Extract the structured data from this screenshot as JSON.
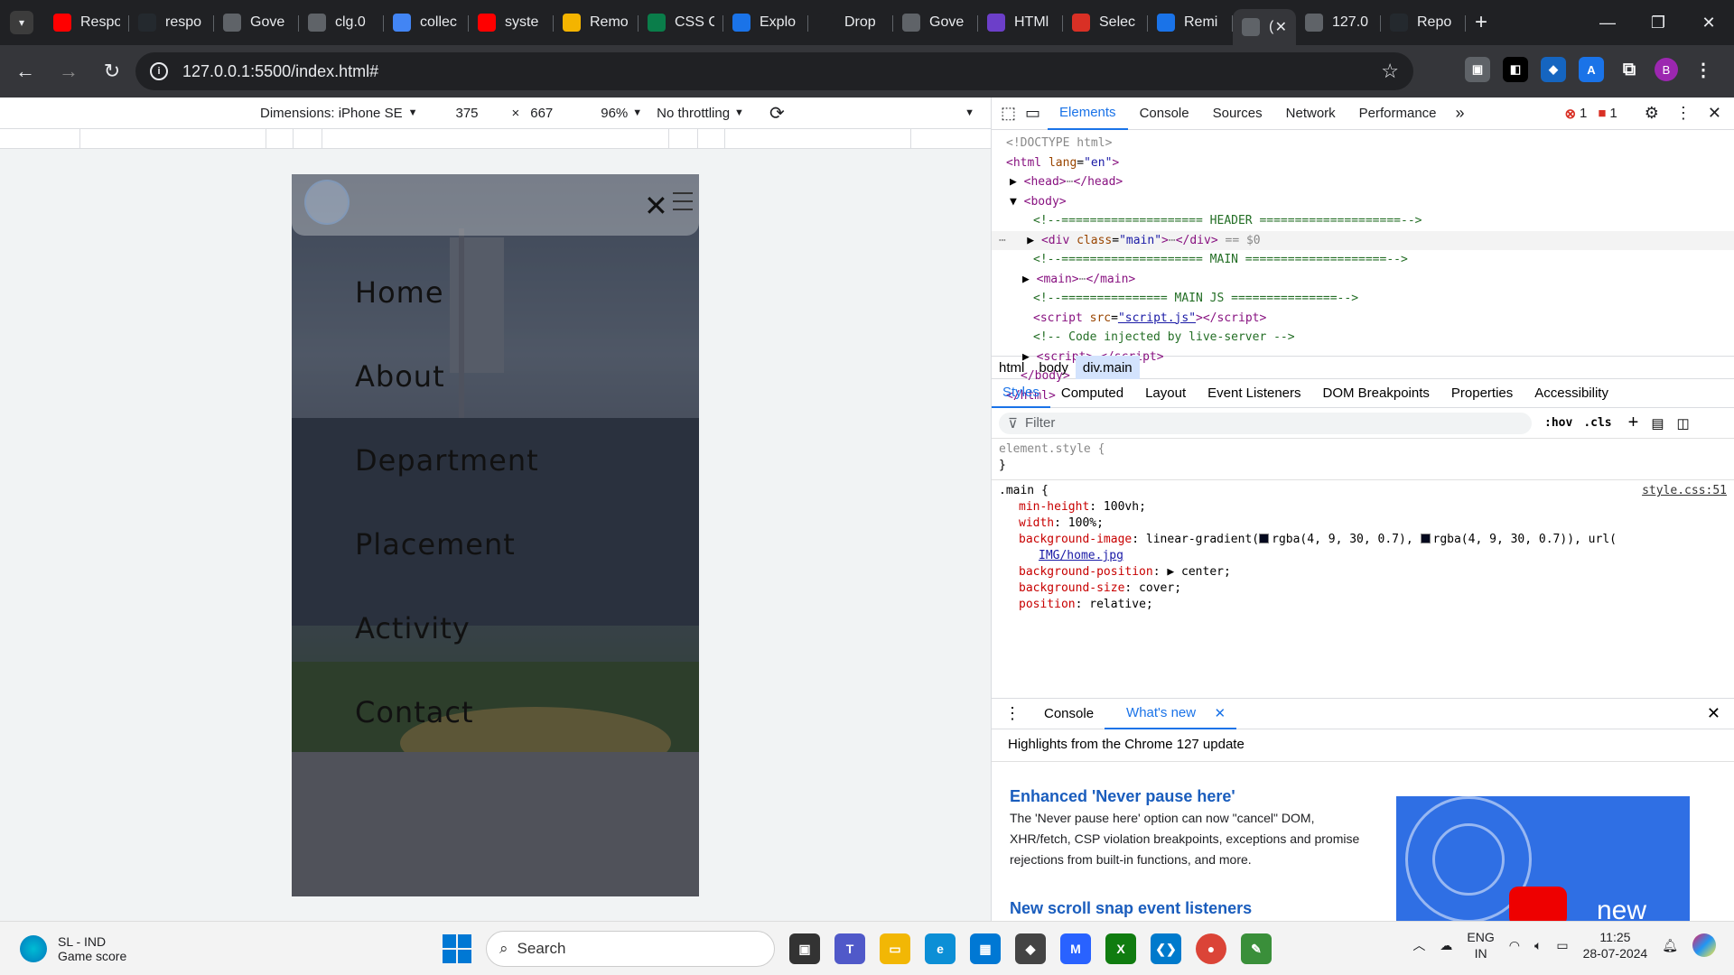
{
  "browser": {
    "tabs": [
      {
        "title": "Respo",
        "icon": "youtube-icon",
        "color": "#ff0000"
      },
      {
        "title": "respo",
        "icon": "github-icon",
        "color": "#24292e"
      },
      {
        "title": "Gove",
        "icon": "page-icon",
        "color": "#5f6368"
      },
      {
        "title": "clg.0",
        "icon": "page-icon",
        "color": "#5f6368"
      },
      {
        "title": "collec",
        "icon": "google-icon",
        "color": "#4285f4"
      },
      {
        "title": "syste",
        "icon": "youtube-icon",
        "color": "#ff0000"
      },
      {
        "title": "Remo",
        "icon": "folder-icon",
        "color": "#f4b400"
      },
      {
        "title": "CSS C",
        "icon": "w-icon",
        "color": "#0a7d4a"
      },
      {
        "title": "Explo",
        "icon": "globe-icon",
        "color": "#1a73e8"
      },
      {
        "title": "Drop",
        "icon": "openai-icon",
        "color": "#202124"
      },
      {
        "title": "Gove",
        "icon": "page-icon",
        "color": "#5f6368"
      },
      {
        "title": "HTMl",
        "icon": "six-icon",
        "color": "#6c3fc9"
      },
      {
        "title": "Selec",
        "icon": "code-icon",
        "color": "#d93025"
      },
      {
        "title": "Remi",
        "icon": "doc-icon",
        "color": "#1a73e8"
      }
    ],
    "active_tab": {
      "title": "(",
      "icon": "page-icon"
    },
    "after_tabs": [
      {
        "title": "127.0",
        "icon": "page-icon",
        "color": "#5f6368"
      },
      {
        "title": "Repo",
        "icon": "github-icon",
        "color": "#24292e"
      }
    ],
    "url": "127.0.0.1:5500/index.html#"
  },
  "device_toolbar": {
    "dimensions": "Dimensions: iPhone SE",
    "width": "375",
    "times": "×",
    "height": "667",
    "zoom": "96%",
    "throttling": "No throttling"
  },
  "site": {
    "menu": [
      "Home",
      "About",
      "Department",
      "Placement",
      "Activity",
      "Contact"
    ]
  },
  "devtools": {
    "tabs": [
      "Elements",
      "Console",
      "Sources",
      "Network",
      "Performance"
    ],
    "active": "Elements",
    "errors": "1",
    "issues": "1",
    "breadcrumb": [
      "html",
      "body",
      "div.main"
    ],
    "sub_tabs": [
      "Styles",
      "Computed",
      "Layout",
      "Event Listeners",
      "DOM Breakpoints",
      "Properties",
      "Accessibility"
    ],
    "filter_placeholder": "Filter",
    "hov": ":hov",
    "cls": ".cls",
    "element_style": "element.style {",
    "rule_source": "style.css:51",
    "drawer_tabs": [
      "Console",
      "What's new"
    ],
    "whats_new_title": "Highlights from the Chrome 127 update",
    "highlight1": "Enhanced 'Never pause here'",
    "highlight1_text": "The 'Never pause here' option can now \"cancel\" DOM, XHR/fetch, CSP violation breakpoints, exceptions and promise rejections from built-in functions, and more.",
    "highlight2": "New scroll snap event listeners",
    "promo_text": "new"
  },
  "taskbar": {
    "weather_title": "SL - IND",
    "weather_sub": "Game score",
    "search": "Search",
    "lang1": "ENG",
    "lang2": "IN",
    "time": "11:25",
    "date": "28-07-2024"
  }
}
